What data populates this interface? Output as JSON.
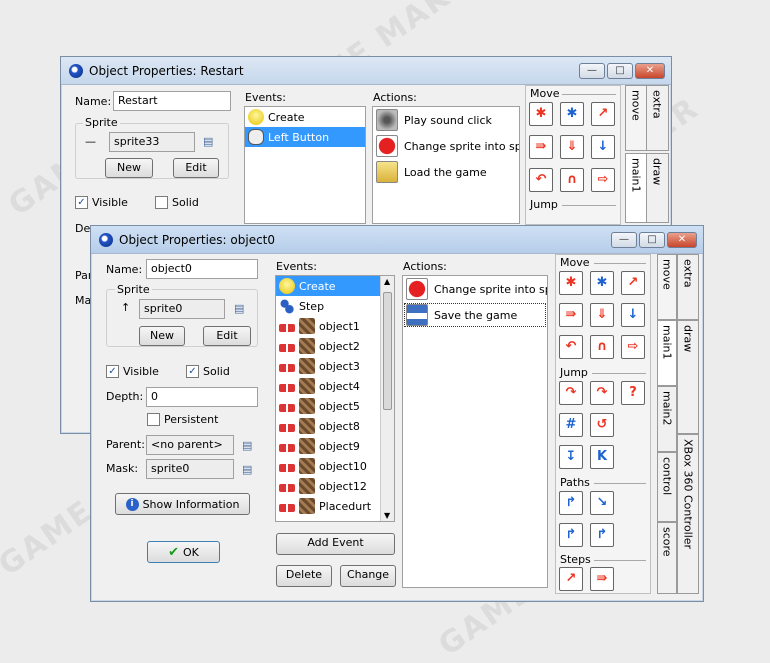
{
  "watermark": "GAME MAKER",
  "back_window": {
    "title": "Object Properties: Restart",
    "name_label": "Name:",
    "name_value": "Restart",
    "sprite_group": "Sprite",
    "sprite_value": "sprite33",
    "new_label": "New",
    "edit_label": "Edit",
    "visible_label": "Visible",
    "solid_label": "Solid",
    "depth_label": "Dep",
    "parent_label": "Par",
    "mask_label": "Ma",
    "events_label": "Events:",
    "events": [
      {
        "label": "Create",
        "icon": "bulb-icon",
        "selected": false
      },
      {
        "label": "Left Button",
        "icon": "mouse-icon",
        "selected": true
      }
    ],
    "actions_label": "Actions:",
    "actions": [
      {
        "label": "Play sound click",
        "icon": "speaker-icon"
      },
      {
        "label": "Change sprite into sprite",
        "icon": "pacman-icon"
      },
      {
        "label": "Load the game",
        "icon": "open-folder-icon"
      }
    ],
    "palette": {
      "move_label": "Move",
      "jump_label": "Jump"
    },
    "tabs": [
      "extra",
      "move",
      "draw",
      "main1"
    ]
  },
  "front_window": {
    "title": "Object Properties: object0",
    "name_label": "Name:",
    "name_value": "object0",
    "sprite_group": "Sprite",
    "sprite_value": "sprite0",
    "new_label": "New",
    "edit_label": "Edit",
    "visible_label": "Visible",
    "visible_checked": true,
    "solid_label": "Solid",
    "solid_checked": true,
    "depth_label": "Depth:",
    "depth_value": "0",
    "persistent_label": "Persistent",
    "persistent_checked": false,
    "parent_label": "Parent:",
    "parent_value": "<no parent>",
    "mask_label": "Mask:",
    "mask_value": "sprite0",
    "show_info_label": "Show Information",
    "ok_label": "OK",
    "events_label": "Events:",
    "events": [
      {
        "label": "Create",
        "icon": "bulb-icon",
        "selected": true
      },
      {
        "label": "Step",
        "icon": "footsteps-icon",
        "selected": false
      },
      {
        "label": "object1",
        "icon": "collision-icon",
        "selected": false
      },
      {
        "label": "object2",
        "icon": "collision-icon",
        "selected": false
      },
      {
        "label": "object3",
        "icon": "collision-icon",
        "selected": false
      },
      {
        "label": "object4",
        "icon": "collision-icon",
        "selected": false
      },
      {
        "label": "object5",
        "icon": "collision-icon",
        "selected": false
      },
      {
        "label": "object8",
        "icon": "collision-icon",
        "selected": false
      },
      {
        "label": "object9",
        "icon": "collision-icon",
        "selected": false
      },
      {
        "label": "object10",
        "icon": "collision-icon",
        "selected": false
      },
      {
        "label": "object12",
        "icon": "collision-icon",
        "selected": false
      },
      {
        "label": "Placedurt",
        "icon": "collision-icon",
        "selected": false
      }
    ],
    "add_event_label": "Add Event",
    "delete_label": "Delete",
    "change_label": "Change",
    "actions_label": "Actions:",
    "actions": [
      {
        "label": "Change sprite into sprite",
        "icon": "pacman-icon"
      },
      {
        "label": "Save the game",
        "icon": "floppy-icon"
      }
    ],
    "palette": {
      "move_label": "Move",
      "jump_label": "Jump",
      "paths_label": "Paths",
      "steps_label": "Steps"
    },
    "tabs": [
      "extra",
      "move",
      "draw",
      "main1",
      "main2",
      "XBox 360 Controller",
      "control",
      "score"
    ]
  },
  "colors": {
    "selection": "#3399ff",
    "titlebar": "#c6d7ec",
    "close": "#c9452c"
  }
}
